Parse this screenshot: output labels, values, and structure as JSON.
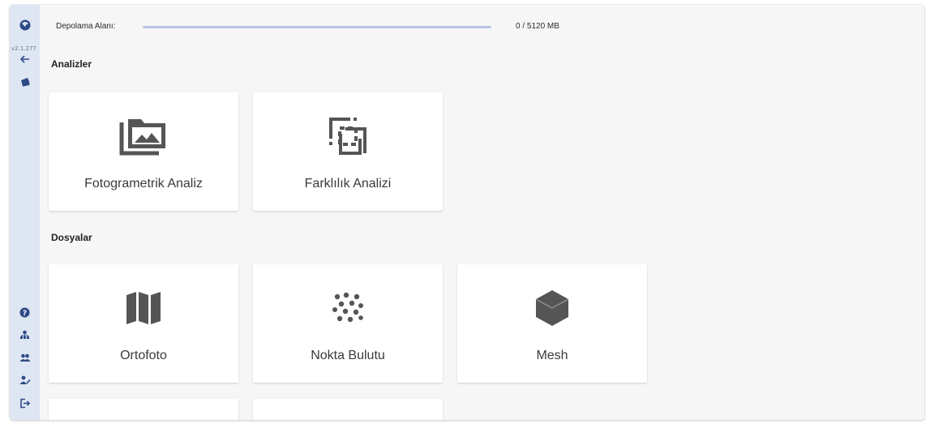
{
  "sidebar": {
    "version": "v2.1.277",
    "icons": [
      "logo-icon",
      "back-arrow-icon",
      "wallet-icon",
      "help-icon",
      "user-tree-icon",
      "users-icon",
      "user-edit-icon",
      "logout-icon"
    ]
  },
  "storage": {
    "label": "Depolama Alanı:",
    "value": "0 / 5120 MB",
    "used_fraction": 0
  },
  "sections": {
    "analyses": {
      "title": "Analizler",
      "cards": [
        {
          "label": "Fotogrametrik Analiz",
          "icon": "photo-library-icon"
        },
        {
          "label": "Farklılık Analizi",
          "icon": "difference-icon"
        }
      ]
    },
    "files": {
      "title": "Dosyalar",
      "cards": [
        {
          "label": "Ortofoto",
          "icon": "map-icon"
        },
        {
          "label": "Nokta Bulutu",
          "icon": "point-cloud-icon"
        },
        {
          "label": "Mesh",
          "icon": "cube-icon"
        }
      ]
    }
  },
  "colors": {
    "sidebar_bg": "#dee6f3",
    "accent": "#2e4a86",
    "icon_gray": "#555555"
  }
}
